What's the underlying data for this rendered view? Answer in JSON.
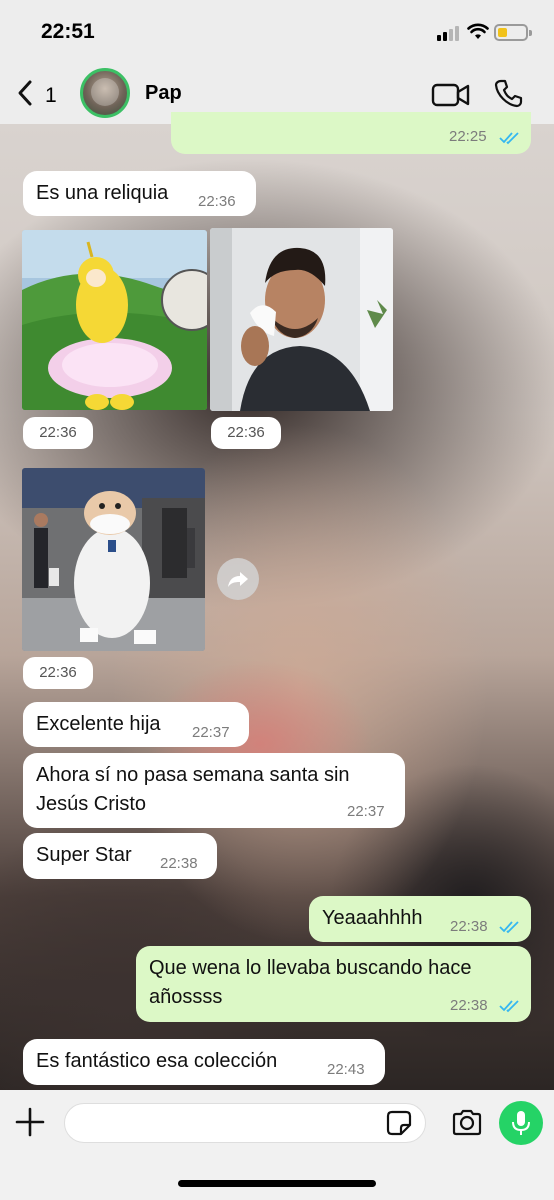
{
  "status_bar": {
    "time": "22:51"
  },
  "header": {
    "unread_count": "1",
    "contact_name": "Pap"
  },
  "messages": [
    {
      "direction": "out",
      "time": "22:25",
      "read": true
    },
    {
      "direction": "in",
      "text": "Es una reliquia",
      "time": "22:36"
    },
    {
      "direction": "in",
      "type": "image",
      "subject": "yellow teletubby in tutu",
      "time": "22:36"
    },
    {
      "direction": "in",
      "type": "image",
      "subject": "man wiping tear",
      "time": "22:36"
    },
    {
      "direction": "in",
      "type": "image",
      "subject": "mascot costume dancing",
      "time": "22:36"
    },
    {
      "direction": "in",
      "text": "Excelente hija",
      "time": "22:37"
    },
    {
      "direction": "in",
      "text_line1": "Ahora sí no pasa semana santa sin",
      "text_line2": "Jesús Cristo",
      "time": "22:37"
    },
    {
      "direction": "in",
      "text": "Super Star",
      "time": "22:38"
    },
    {
      "direction": "out",
      "text": "Yeaaahhhh",
      "time": "22:38",
      "read": true
    },
    {
      "direction": "out",
      "text_line1": "Que wena lo llevaba buscando hace",
      "text_line2": "añossss",
      "time": "22:38",
      "read": true
    },
    {
      "direction": "in",
      "text": "Es fantástico esa colección",
      "time": "22:43"
    }
  ],
  "composer": {
    "placeholder": ""
  },
  "colors": {
    "outgoing_bubble": "#dcf8c6",
    "incoming_bubble": "#ffffff",
    "read_ticks": "#34b7f1",
    "accent_green": "#25d366",
    "avatar_ring": "#3cc065"
  },
  "icons": [
    "back-chevron-icon",
    "video-call-icon",
    "voice-call-icon",
    "plus-icon",
    "sticker-icon",
    "camera-icon",
    "microphone-icon",
    "forward-icon",
    "double-check-icon"
  ]
}
